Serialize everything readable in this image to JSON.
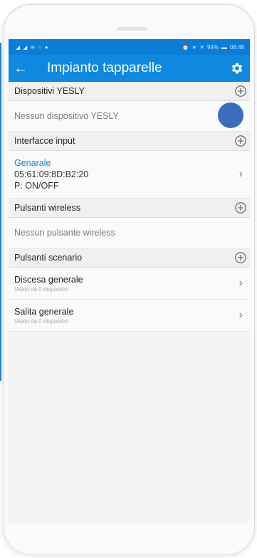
{
  "status_bar": {
    "left_icons": [
      "signal-icon",
      "signal-icon",
      "wifi-icon",
      "headset-icon",
      "notification-icon"
    ],
    "battery": "94%",
    "time": "08:48"
  },
  "app_bar": {
    "title": "Impianto tapparelle",
    "back_icon": "arrow-left-icon",
    "settings_icon": "gear-icon"
  },
  "sections": {
    "yesly": {
      "label": "Dispositivi YESLY",
      "empty": "Nessun dispositivo YESLY"
    },
    "inputs": {
      "label": "Interfacce input",
      "items": [
        {
          "name": "Genarale",
          "address": "05:61:09:8D:B2:20",
          "mode": "P: ON/OFF"
        }
      ]
    },
    "wireless": {
      "label": "Pulsanti wireless",
      "empty": "Nessun pulsante wireless"
    },
    "scenarios": {
      "label": "Pulsanti scenario",
      "items": [
        {
          "name": "Discesa generale",
          "sub": "Usato da 0 dispositivi"
        },
        {
          "name": "Salita generale",
          "sub": "Usato da 0 dispositivi"
        }
      ]
    }
  },
  "colors": {
    "accent": "#0f88e0",
    "status_bar": "#0a7dd6",
    "touch_indicator": "#3a6ebd"
  }
}
